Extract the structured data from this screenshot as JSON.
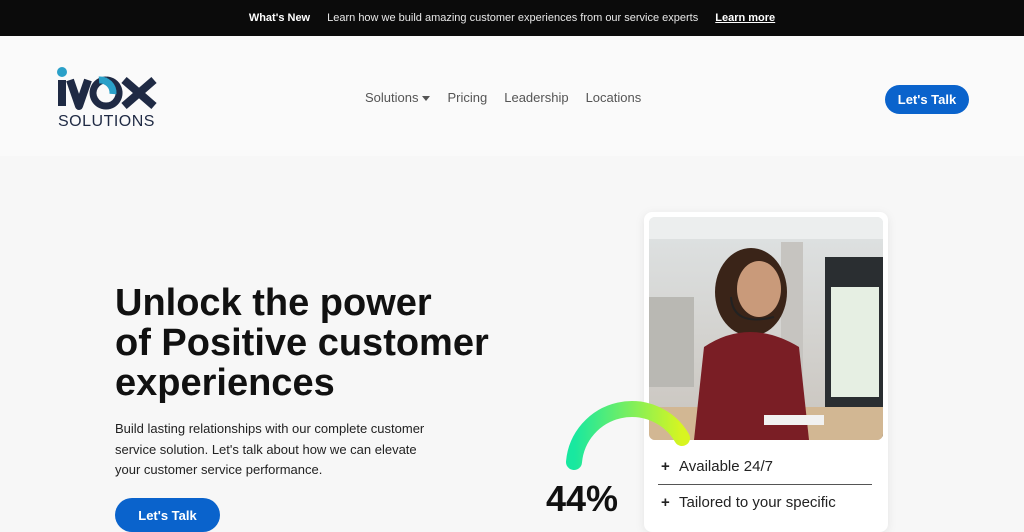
{
  "announcement": {
    "label": "What's New",
    "message": "Learn how we build amazing customer experiences from our service experts",
    "link": "Learn more"
  },
  "brand": {
    "word": "IVOX",
    "sub": "SOLUTIONS",
    "accent": "#2aa0c8",
    "dark": "#1f2a44"
  },
  "nav": {
    "items": [
      "Solutions",
      "Pricing",
      "Leadership",
      "Locations"
    ],
    "cta": "Let's Talk"
  },
  "hero": {
    "title_line1": "Unlock the power",
    "title_line2": "of Positive customer",
    "title_line3": "experiences",
    "body": "Build lasting relationships with our complete customer service solution. Let's talk about how we can elevate your customer service performance.",
    "cta": "Let's Talk"
  },
  "stats": {
    "percent": "44%",
    "gauge_colors": [
      "#18e8a0",
      "#d8f520"
    ]
  },
  "features": [
    "Available 24/7",
    "Tailored to your specific"
  ],
  "colors": {
    "primary": "#0a63cc",
    "topbar": "#0b0b0b"
  }
}
